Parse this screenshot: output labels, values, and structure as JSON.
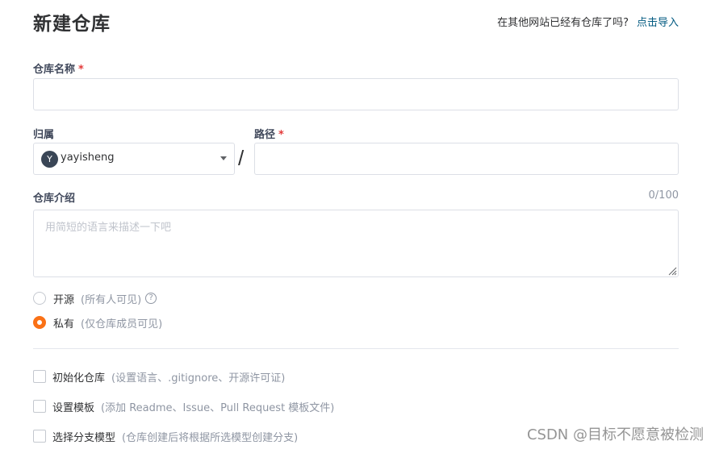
{
  "header": {
    "title": "新建仓库",
    "import_question": "在其他网站已经有仓库了吗?",
    "import_link": "点击导入"
  },
  "repo_name": {
    "label": "仓库名称",
    "required_mark": "*",
    "value": ""
  },
  "owner": {
    "label": "归属",
    "avatar_letter": "Y",
    "selected": "yayisheng",
    "separator": "/"
  },
  "path": {
    "label": "路径",
    "required_mark": "*",
    "value": ""
  },
  "description": {
    "label": "仓库介绍",
    "counter": "0/100",
    "placeholder": "用简短的语言来描述一下吧"
  },
  "visibility": {
    "options": [
      {
        "label": "开源",
        "note": "(所有人可见)",
        "checked": false,
        "has_help": true
      },
      {
        "label": "私有",
        "note": "(仅仓库成员可见)",
        "checked": true,
        "has_help": false
      }
    ],
    "help_glyph": "?"
  },
  "options": [
    {
      "label": "初始化仓库",
      "note": "(设置语言、.gitignore、开源许可证)",
      "checked": false
    },
    {
      "label": "设置模板",
      "note": "(添加 Readme、Issue、Pull Request 模板文件)",
      "checked": false
    },
    {
      "label": "选择分支模型",
      "note": "(仓库创建后将根据所选模型创建分支)",
      "checked": false
    }
  ],
  "watermark": "CSDN @目标不愿意被检测",
  "colors": {
    "accent": "#fa7116",
    "link": "#005980",
    "required": "#e33a3a",
    "muted": "#8f96a3"
  }
}
